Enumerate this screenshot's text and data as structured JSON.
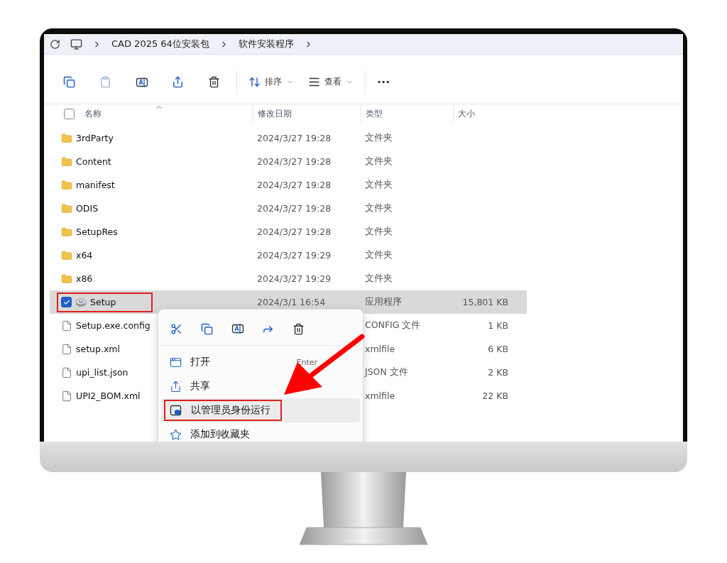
{
  "address_bar": {
    "crumbs": [
      "CAD 2025 64位安装包",
      "软件安装程序"
    ]
  },
  "toolbar": {
    "sort_label": "排序",
    "view_label": "查看",
    "more": "···"
  },
  "header": {
    "select_all_checked": false
  },
  "columns": [
    "名称",
    "修改日期",
    "类型",
    "大小"
  ],
  "rows": [
    {
      "kind": "folder",
      "name": "3rdParty",
      "date": "2024/3/27 19:28",
      "type": "文件夹",
      "size": "",
      "selected": false,
      "highlighted": false
    },
    {
      "kind": "folder",
      "name": "Content",
      "date": "2024/3/27 19:28",
      "type": "文件夹",
      "size": "",
      "selected": false,
      "highlighted": false
    },
    {
      "kind": "folder",
      "name": "manifest",
      "date": "2024/3/27 19:28",
      "type": "文件夹",
      "size": "",
      "selected": false,
      "highlighted": false
    },
    {
      "kind": "folder",
      "name": "ODIS",
      "date": "2024/3/27 19:28",
      "type": "文件夹",
      "size": "",
      "selected": false,
      "highlighted": false
    },
    {
      "kind": "folder",
      "name": "SetupRes",
      "date": "2024/3/27 19:28",
      "type": "文件夹",
      "size": "",
      "selected": false,
      "highlighted": false
    },
    {
      "kind": "folder",
      "name": "x64",
      "date": "2024/3/27 19:29",
      "type": "文件夹",
      "size": "",
      "selected": false,
      "highlighted": false
    },
    {
      "kind": "folder",
      "name": "x86",
      "date": "2024/3/27 19:29",
      "type": "文件夹",
      "size": "",
      "selected": false,
      "highlighted": false
    },
    {
      "kind": "app",
      "name": "Setup",
      "date": "2024/3/1 16:54",
      "type": "应用程序",
      "size": "15,801 KB",
      "selected": true,
      "highlighted": true
    },
    {
      "kind": "file",
      "name": "Setup.exe.config",
      "date": "",
      "type": "CONFIG 文件",
      "size": "1 KB",
      "selected": false,
      "highlighted": false
    },
    {
      "kind": "file",
      "name": "setup.xml",
      "date": "",
      "type": "xmlfile",
      "size": "6 KB",
      "selected": false,
      "highlighted": false
    },
    {
      "kind": "file",
      "name": "upi_list.json",
      "date": "",
      "type": "JSON 文件",
      "size": "2 KB",
      "selected": false,
      "highlighted": false
    },
    {
      "kind": "file",
      "name": "UPI2_BOM.xml",
      "date": "",
      "type": "xmlfile",
      "size": "22 KB",
      "selected": false,
      "highlighted": false
    }
  ],
  "context_menu": {
    "items": [
      {
        "kind": "open",
        "label": "打开",
        "shortcut": "Enter",
        "hovered": false,
        "highlighted": false
      },
      {
        "kind": "share",
        "label": "共享",
        "hovered": false,
        "highlighted": false
      },
      {
        "kind": "admin",
        "label": "以管理员身份运行",
        "hovered": true,
        "highlighted": true
      },
      {
        "kind": "favorite",
        "label": "添加到收藏夹",
        "hovered": false,
        "highlighted": false
      }
    ]
  },
  "annotation": {
    "arrow": true
  }
}
